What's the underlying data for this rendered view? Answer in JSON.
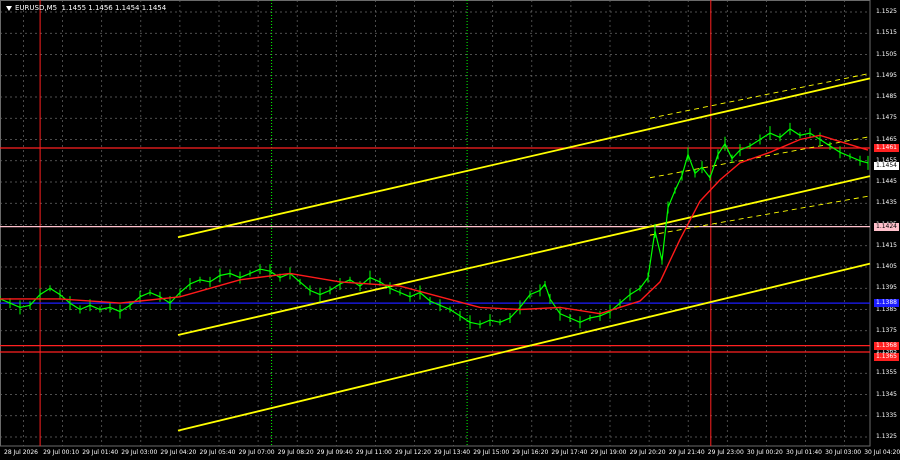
{
  "header": {
    "symbol": "EURUSD,M5",
    "ohlc": "1.1455 1.1456 1.1454 1.1454"
  },
  "chart_data": {
    "type": "line",
    "symbol": "EURUSD,M5",
    "timeframe": "M5",
    "ylim": [
      1.132,
      1.153
    ],
    "yticks": [
      "1.1525",
      "1.1515",
      "1.1505",
      "1.1495",
      "1.1485",
      "1.1475",
      "1.1465",
      "1.1455",
      "1.1445",
      "1.1435",
      "1.1425",
      "1.1415",
      "1.1405",
      "1.1395",
      "1.1385",
      "1.1375",
      "1.1365",
      "1.1355",
      "1.1345",
      "1.1335",
      "1.1325"
    ],
    "xticks": [
      "28 Jul 2026",
      "29 Jul 00:10",
      "29 Jul 01:40",
      "29 Jul 03:00",
      "29 Jul 04:20",
      "29 Jul 05:40",
      "29 Jul 07:00",
      "29 Jul 08:20",
      "29 Jul 09:40",
      "29 Jul 11:00",
      "29 Jul 12:20",
      "29 Jul 13:40",
      "29 Jul 15:00",
      "29 Jul 16:20",
      "29 Jul 17:40",
      "29 Jul 19:00",
      "29 Jul 20:20",
      "29 Jul 21:40",
      "29 Jul 23:00",
      "30 Jul 00:20",
      "30 Jul 01:40",
      "30 Jul 03:00",
      "30 Jul 04:20"
    ],
    "price_series": [
      [
        0,
        1.139
      ],
      [
        10,
        1.1388
      ],
      [
        20,
        1.1386
      ],
      [
        30,
        1.1387
      ],
      [
        40,
        1.1392
      ],
      [
        50,
        1.1395
      ],
      [
        60,
        1.1392
      ],
      [
        70,
        1.1388
      ],
      [
        80,
        1.1385
      ],
      [
        90,
        1.1387
      ],
      [
        100,
        1.1385
      ],
      [
        110,
        1.1386
      ],
      [
        120,
        1.1384
      ],
      [
        130,
        1.1387
      ],
      [
        140,
        1.1391
      ],
      [
        150,
        1.1393
      ],
      [
        160,
        1.1391
      ],
      [
        170,
        1.1388
      ],
      [
        180,
        1.1393
      ],
      [
        190,
        1.1397
      ],
      [
        200,
        1.1399
      ],
      [
        210,
        1.1398
      ],
      [
        220,
        1.1401
      ],
      [
        230,
        1.1402
      ],
      [
        240,
        1.14
      ],
      [
        250,
        1.1402
      ],
      [
        260,
        1.1404
      ],
      [
        270,
        1.1403
      ],
      [
        280,
        1.14
      ],
      [
        290,
        1.1402
      ],
      [
        300,
        1.1398
      ],
      [
        310,
        1.1394
      ],
      [
        320,
        1.1392
      ],
      [
        330,
        1.1394
      ],
      [
        340,
        1.1397
      ],
      [
        350,
        1.1399
      ],
      [
        360,
        1.1396
      ],
      [
        370,
        1.14
      ],
      [
        380,
        1.1398
      ],
      [
        390,
        1.1395
      ],
      [
        400,
        1.1393
      ],
      [
        410,
        1.1391
      ],
      [
        420,
        1.1393
      ],
      [
        430,
        1.1389
      ],
      [
        440,
        1.1387
      ],
      [
        450,
        1.1385
      ],
      [
        460,
        1.1382
      ],
      [
        470,
        1.1379
      ],
      [
        480,
        1.1378
      ],
      [
        490,
        1.138
      ],
      [
        500,
        1.1379
      ],
      [
        510,
        1.1381
      ],
      [
        520,
        1.1386
      ],
      [
        530,
        1.1392
      ],
      [
        540,
        1.1394
      ],
      [
        545,
        1.1397
      ],
      [
        550,
        1.139
      ],
      [
        560,
        1.1383
      ],
      [
        570,
        1.1381
      ],
      [
        580,
        1.1379
      ],
      [
        590,
        1.1381
      ],
      [
        600,
        1.1382
      ],
      [
        610,
        1.1384
      ],
      [
        620,
        1.1388
      ],
      [
        630,
        1.1392
      ],
      [
        640,
        1.1395
      ],
      [
        648,
        1.14
      ],
      [
        655,
        1.1422
      ],
      [
        662,
        1.1408
      ],
      [
        668,
        1.1433
      ],
      [
        675,
        1.1441
      ],
      [
        682,
        1.1448
      ],
      [
        688,
        1.1458
      ],
      [
        695,
        1.1449
      ],
      [
        702,
        1.1452
      ],
      [
        710,
        1.1447
      ],
      [
        718,
        1.1458
      ],
      [
        725,
        1.1463
      ],
      [
        732,
        1.1456
      ],
      [
        740,
        1.146
      ],
      [
        750,
        1.1462
      ],
      [
        760,
        1.1465
      ],
      [
        770,
        1.1468
      ],
      [
        780,
        1.1466
      ],
      [
        790,
        1.147
      ],
      [
        800,
        1.1467
      ],
      [
        810,
        1.1468
      ],
      [
        820,
        1.1465
      ],
      [
        830,
        1.1462
      ],
      [
        840,
        1.1459
      ],
      [
        850,
        1.1457
      ],
      [
        860,
        1.1455
      ],
      [
        868,
        1.1454
      ]
    ],
    "moving_average": [
      [
        0,
        1.139
      ],
      [
        60,
        1.139
      ],
      [
        120,
        1.1388
      ],
      [
        180,
        1.1391
      ],
      [
        240,
        1.1399
      ],
      [
        290,
        1.1402
      ],
      [
        340,
        1.1398
      ],
      [
        400,
        1.1396
      ],
      [
        440,
        1.1391
      ],
      [
        480,
        1.1386
      ],
      [
        520,
        1.1385
      ],
      [
        560,
        1.1386
      ],
      [
        600,
        1.1383
      ],
      [
        640,
        1.1389
      ],
      [
        660,
        1.1398
      ],
      [
        680,
        1.1418
      ],
      [
        700,
        1.1436
      ],
      [
        720,
        1.1446
      ],
      [
        740,
        1.1454
      ],
      [
        770,
        1.1459
      ],
      [
        800,
        1.1465
      ],
      [
        820,
        1.1467
      ],
      [
        840,
        1.1464
      ],
      [
        868,
        1.146
      ]
    ],
    "horizontal_levels": [
      {
        "price": "1.1461",
        "color": "#ff2020",
        "tag": "1.1461"
      },
      {
        "price": "1.1424",
        "color": "#ffc0cb",
        "tag": "1.1424"
      },
      {
        "price": "1.1388",
        "color": "#1c1cff",
        "tag": "1.1388"
      },
      {
        "price": "1.1368",
        "color": "#ff2020",
        "tag": "1.1368"
      },
      {
        "price": "1.1365",
        "color": "#ff2020",
        "tag": "1.1365"
      }
    ],
    "current_price_tag": "1.1454",
    "channel_lines": [
      {
        "style": "solid",
        "p1": [
          178,
          1.1419
        ],
        "p2": [
          900,
          1.1497
        ]
      },
      {
        "style": "solid",
        "p1": [
          178,
          1.1373
        ],
        "p2": [
          900,
          1.1451
        ]
      },
      {
        "style": "solid",
        "p1": [
          178,
          1.1328
        ],
        "p2": [
          900,
          1.141
        ]
      },
      {
        "style": "dashed",
        "p1": [
          650,
          1.1447
        ],
        "p2": [
          900,
          1.1469
        ]
      },
      {
        "style": "dashed",
        "p1": [
          650,
          1.1475
        ],
        "p2": [
          900,
          1.1499
        ]
      },
      {
        "style": "dashed",
        "p1": [
          650,
          1.142
        ],
        "p2": [
          900,
          1.1441
        ]
      }
    ],
    "vertical_markers": [
      {
        "x_label": "29 Jul 00:10",
        "color": "#ff2020",
        "style": "solid"
      },
      {
        "x_label": "29 Jul 07:00",
        "color": "#00ff00",
        "style": "dotted"
      },
      {
        "x_label": "29 Jul 13:40",
        "color": "#00ff00",
        "style": "dotted"
      },
      {
        "x_label": "29 Jul 23:00",
        "color": "#ff2020",
        "style": "solid"
      }
    ],
    "colors": {
      "background": "#000000",
      "grid": "#6a6a6a",
      "candles": "#00ff00",
      "ma": "#ff1a1a",
      "channel": "#ffff00",
      "axis_text": "#ffffff"
    }
  }
}
